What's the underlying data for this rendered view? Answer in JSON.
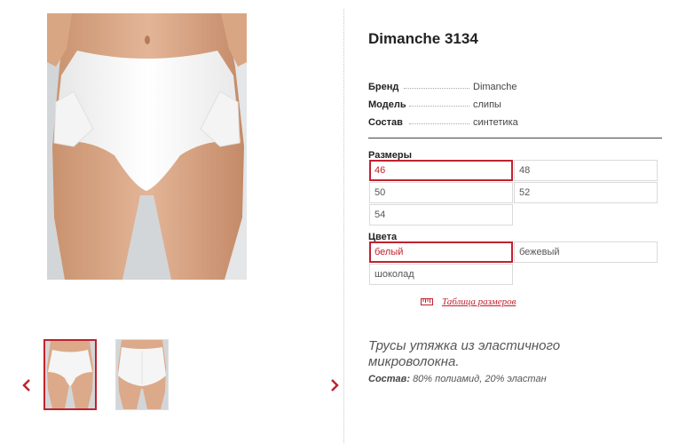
{
  "product": {
    "title": "Dimanche 3134",
    "specs": [
      {
        "label": "Бренд",
        "value": "Dimanche"
      },
      {
        "label": "Модель",
        "value": "слипы"
      },
      {
        "label": "Состав",
        "value": "синтетика"
      }
    ]
  },
  "sizes": {
    "label": "Размеры",
    "options": [
      "46",
      "48",
      "50",
      "52",
      "54"
    ],
    "selected": "46"
  },
  "colors": {
    "label": "Цвета",
    "options": [
      "белый",
      "бежевый",
      "шоколад"
    ],
    "selected": "белый"
  },
  "size_table_link": "Таблица размеров",
  "description": "Трусы утяжка из эластичного микроволокна.",
  "composition": {
    "label": "Состав:",
    "value": "80% полиамид, 20% эластан"
  },
  "gallery": {
    "thumbnails": [
      "front-view",
      "back-view"
    ],
    "selected_index": 0,
    "prev_icon": "chevron-left-icon",
    "next_icon": "chevron-right-icon"
  },
  "colors_palette": {
    "accent": "#c0222f",
    "text": "#333333",
    "border": "#dadada"
  }
}
